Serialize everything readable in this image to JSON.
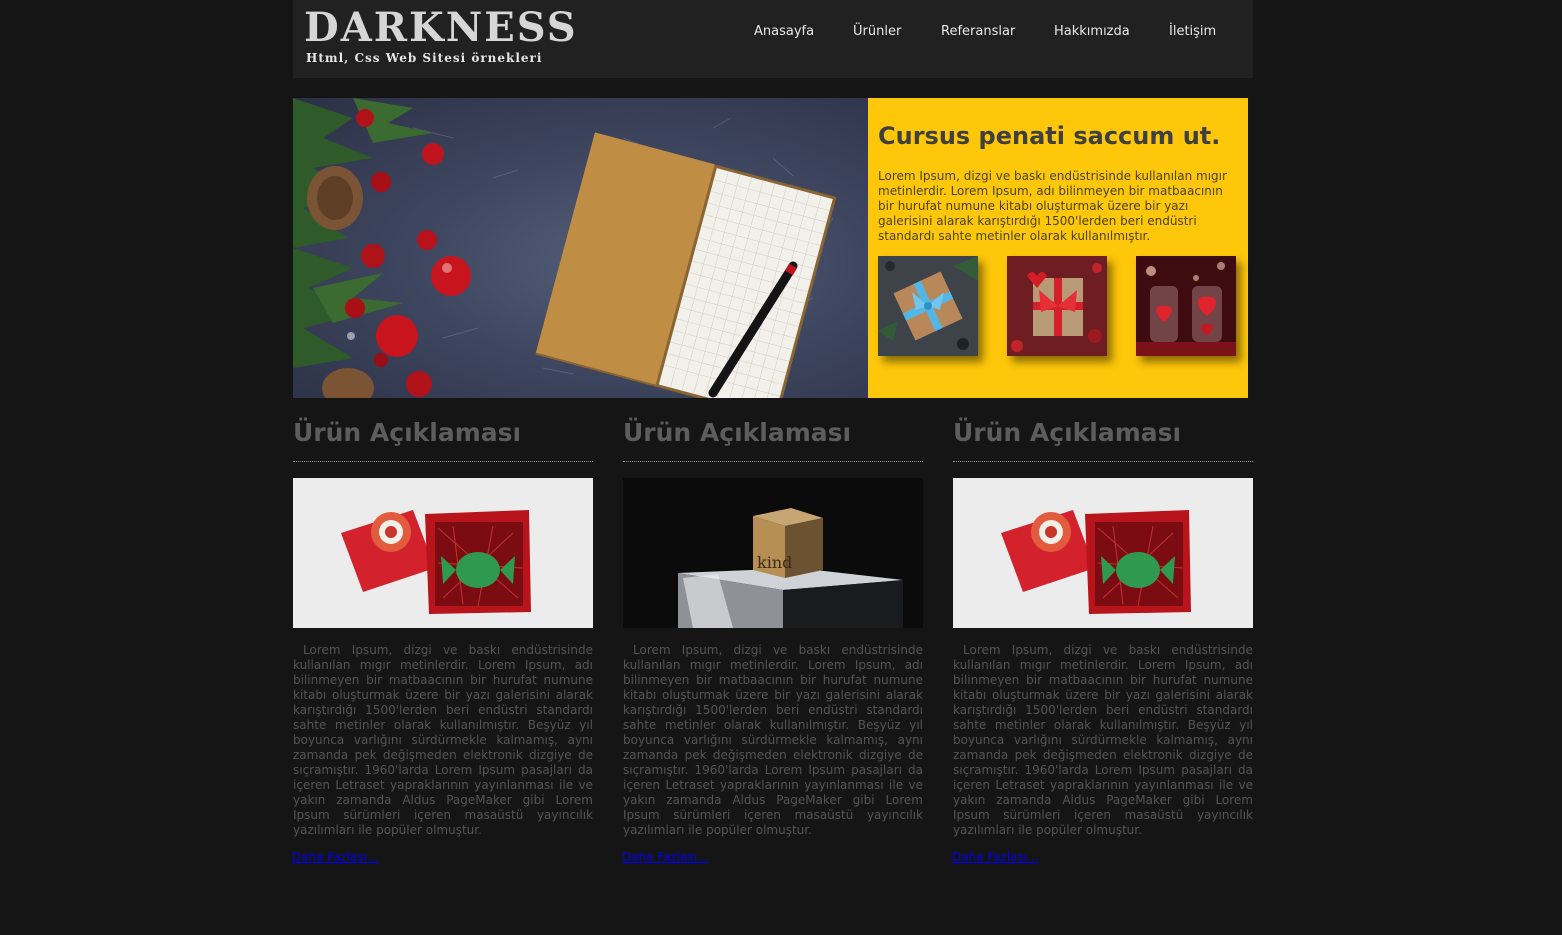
{
  "header": {
    "brand": "DARKNESS",
    "tagline": "Html, Css Web Sitesi örnekleri",
    "nav": [
      "Anasayfa",
      "Ürünler",
      "Referanslar",
      "Hakkımızda",
      "İletişim"
    ]
  },
  "hero": {
    "title": "Cursus penati saccum ut.",
    "text": "Lorem Ipsum, dizgi ve baskı endüstrisinde kullanılan mıgır metinlerdir. Lorem Ipsum, adı bilinmeyen bir matbaacının bir hurufat numune kitabı oluşturmak üzere bir yazı galerisini alarak karıştırdığı 1500'lerden beri endüstri standardı sahte metinler olarak kullanılmıştır.",
    "photo": "notebook-christmas-photo",
    "thumbs": [
      "gift-blue-ribbon-photo",
      "gift-red-ribbon-photo",
      "hearts-jar-photo"
    ]
  },
  "products": [
    {
      "title": "Ürün Açıklaması",
      "image": "red-gift-box-photo",
      "text": "Lorem Ipsum, dizgi ve baskı endüstrisinde kullanılan mıgır metinlerdir. Lorem Ipsum, adı bilinmeyen bir matbaacının bir hurufat numune kitabı oluşturmak üzere bir yazı galerisini alarak karıştırdığı 1500'lerden beri endüstri standardı sahte metinler olarak kullanılmıştır. Beşyüz yıl boyunca varlığını sürdürmekle kalmamış, aynı zamanda pek değişmeden elektronik dizgiye de sıçramıştır. 1960'larda Lorem Ipsum pasajları da içeren Letraset yapraklarının yayınlanması ile ve yakın zamanda Aldus PageMaker gibi Lorem Ipsum sürümleri içeren masaüstü yayıncılık yazılımları ile popüler olmuştur.",
      "more": "Daha Fazlası..."
    },
    {
      "title": "Ürün Açıklaması",
      "image": "kind-box-photo",
      "text": "Lorem Ipsum, dizgi ve baskı endüstrisinde kullanılan mıgır metinlerdir. Lorem Ipsum, adı bilinmeyen bir matbaacının bir hurufat numune kitabı oluşturmak üzere bir yazı galerisini alarak karıştırdığı 1500'lerden beri endüstri standardı sahte metinler olarak kullanılmıştır. Beşyüz yıl boyunca varlığını sürdürmekle kalmamış, aynı zamanda pek değişmeden elektronik dizgiye de sıçramıştır. 1960'larda Lorem Ipsum pasajları da içeren Letraset yapraklarının yayınlanması ile ve yakın zamanda Aldus PageMaker gibi Lorem Ipsum sürümleri içeren masaüstü yayıncılık yazılımları ile popüler olmuştur.",
      "more": "Daha Fazlası...",
      "box_text": "kind"
    },
    {
      "title": "Ürün Açıklaması",
      "image": "red-gift-box-photo",
      "text": "Lorem Ipsum, dizgi ve baskı endüstrisinde kullanılan mıgır metinlerdir. Lorem Ipsum, adı bilinmeyen bir matbaacının bir hurufat numune kitabı oluşturmak üzere bir yazı galerisini alarak karıştırdığı 1500'lerden beri endüstri standardı sahte metinler olarak kullanılmıştır. Beşyüz yıl boyunca varlığını sürdürmekle kalmamış, aynı zamanda pek değişmeden elektronik dizgiye de sıçramıştır. 1960'larda Lorem Ipsum pasajları da içeren Letraset yapraklarının yayınlanması ile ve yakın zamanda Aldus PageMaker gibi Lorem Ipsum sürümleri içeren masaüstü yayıncılık yazılımları ile popüler olmuştur.",
      "more": "Daha Fazlası..."
    }
  ],
  "colors": {
    "background": "#151515",
    "header": "#212121",
    "accent_panel": "#fec70a",
    "heading": "#5d5d5d",
    "link": "#0000ee"
  }
}
